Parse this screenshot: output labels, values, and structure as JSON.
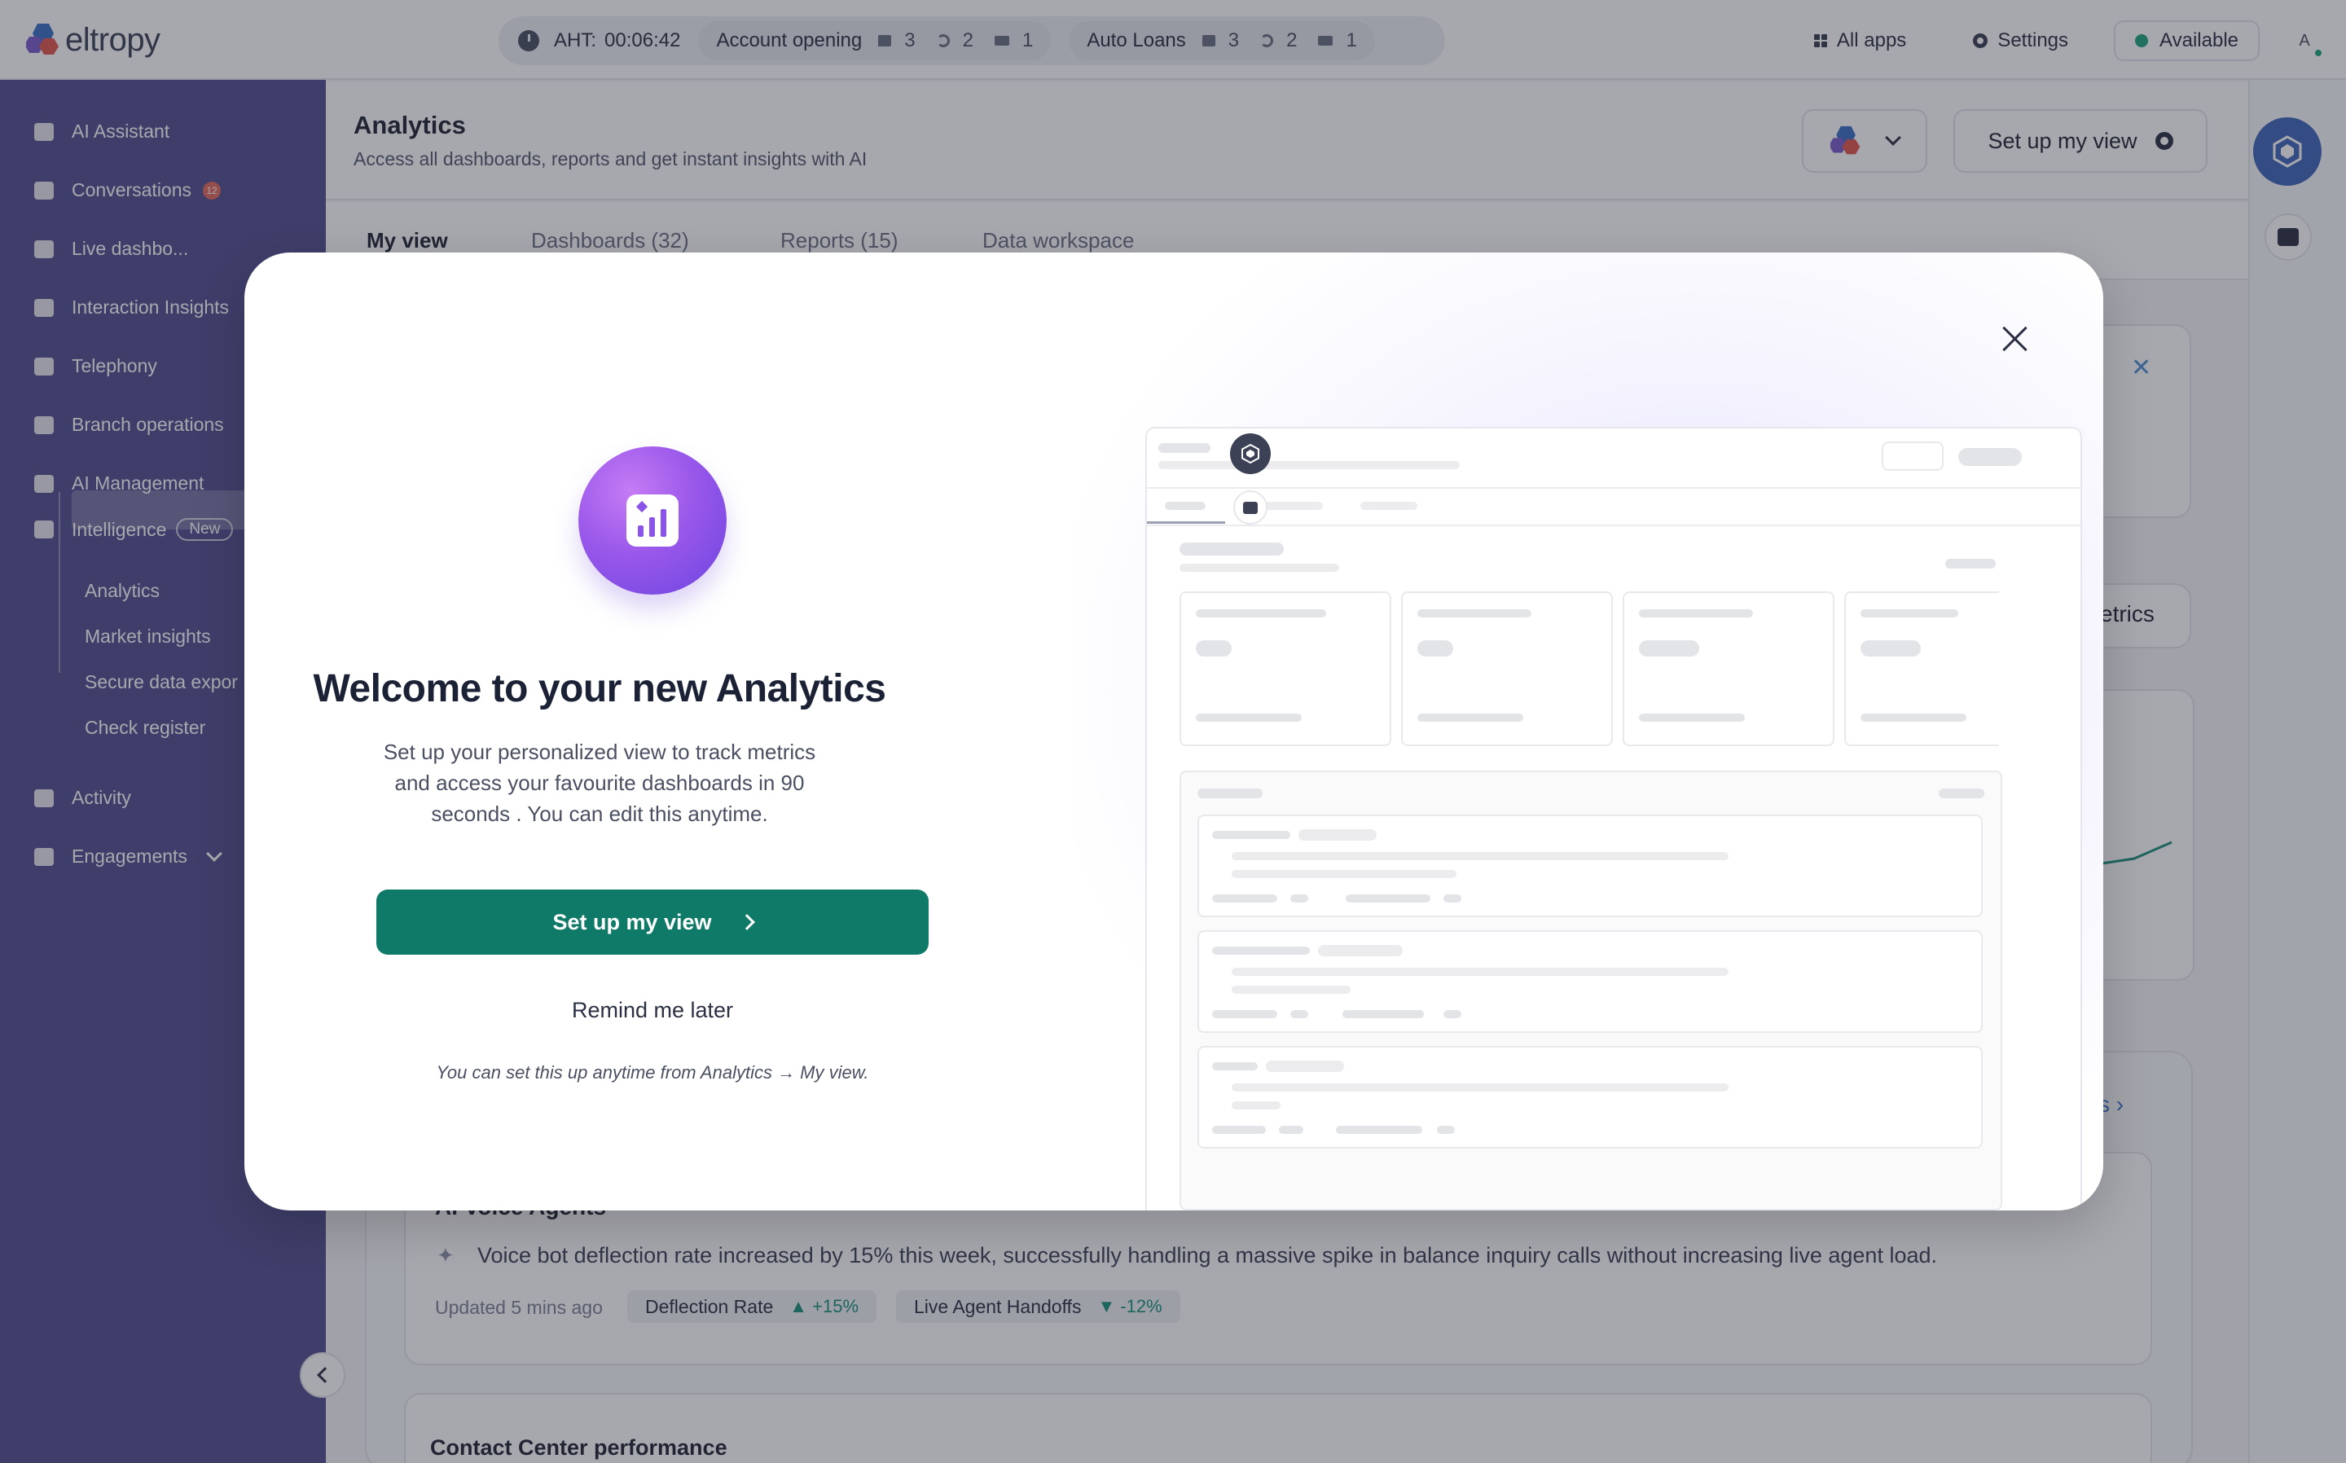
{
  "app": {
    "brand": "eltropy"
  },
  "topbar": {
    "aht_label": "AHT:",
    "aht_value": "00:06:42",
    "queues": [
      {
        "name": "Account opening",
        "chat": "3",
        "call": "2",
        "video": "1"
      },
      {
        "name": "Auto Loans",
        "chat": "3",
        "call": "2",
        "video": "1"
      }
    ],
    "all_apps": "All apps",
    "settings": "Settings",
    "status": "Available",
    "avatar_initial": "A"
  },
  "sidebar": {
    "items": [
      {
        "label": "AI Assistant"
      },
      {
        "label": "Conversations",
        "badge": "12"
      },
      {
        "label": "Live dashbo..."
      },
      {
        "label": "Interaction Insights"
      },
      {
        "label": "Telephony"
      },
      {
        "label": "Branch operations"
      },
      {
        "label": "AI Management"
      },
      {
        "label": "Intelligence",
        "badge": "New"
      },
      {
        "label": "Activity"
      },
      {
        "label": "Engagements"
      }
    ],
    "sub_items": [
      {
        "label": "Analytics"
      },
      {
        "label": "Market insights"
      },
      {
        "label": "Secure data expor"
      },
      {
        "label": "Check register"
      }
    ]
  },
  "header": {
    "title": "Analytics",
    "subtitle": "Access all dashboards, reports and get instant insights with AI",
    "setup_button": "Set up my view"
  },
  "tabs": [
    {
      "label": "My view"
    },
    {
      "label": "Dashboards (32)"
    },
    {
      "label": "Reports (15)"
    },
    {
      "label": "Data workspace"
    }
  ],
  "background": {
    "metrics_fragment": "etrics",
    "link_fragment": "s",
    "cut_title": "AI Voice Agents",
    "insight": "Voice bot deflection rate increased by 15% this week, successfully handling a massive spike in balance inquiry calls without increasing live agent load.",
    "updated": "Updated 5 mins ago",
    "chips": [
      {
        "label": "Deflection Rate",
        "delta": "+15%"
      },
      {
        "label": "Live Agent Handoffs",
        "delta": "-12%"
      }
    ],
    "section_title": "Contact Center performance"
  },
  "modal": {
    "title": "Welcome to your new Analytics",
    "description": "Set up your personalized view to track metrics and access your favourite dashboards in 90 seconds . You can edit this anytime.",
    "primary_button": "Set up my view",
    "secondary_button": "Remind me later",
    "footnote": "You can set this up anytime from Analytics → My view."
  },
  "colors": {
    "sidebar": "#534f8e",
    "primary": "#0f7a67",
    "hero_gradient": "#9a58ea",
    "status_available": "#1fa37c"
  }
}
